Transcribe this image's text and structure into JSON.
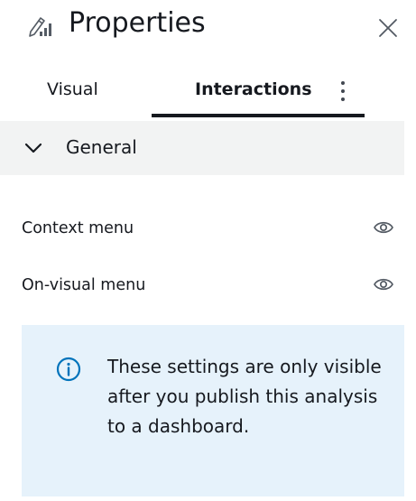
{
  "header": {
    "title": "Properties",
    "icon": "properties-pencil-chart-icon",
    "close_icon": "close-icon"
  },
  "tabs": [
    {
      "label": "Visual",
      "selected": false
    },
    {
      "label": "Interactions",
      "selected": true
    }
  ],
  "tabs_menu_icon": "kebab-menu-icon",
  "section": {
    "label": "General",
    "expanded": true,
    "icon": "chevron-down-icon"
  },
  "rows": [
    {
      "label": "Context menu",
      "icon": "eye-icon"
    },
    {
      "label": "On-visual menu",
      "icon": "eye-icon"
    }
  ],
  "alert": {
    "icon": "info-icon",
    "text": "These settings are only visible after you publish this analysis to a dashboard."
  },
  "colors": {
    "text": "#16191f",
    "icon_gray": "#545b64",
    "section_bg": "#f2f3f3",
    "alert_bg": "#e6f2fb",
    "info_blue": "#0073bb",
    "tab_underline": "#16191f"
  }
}
